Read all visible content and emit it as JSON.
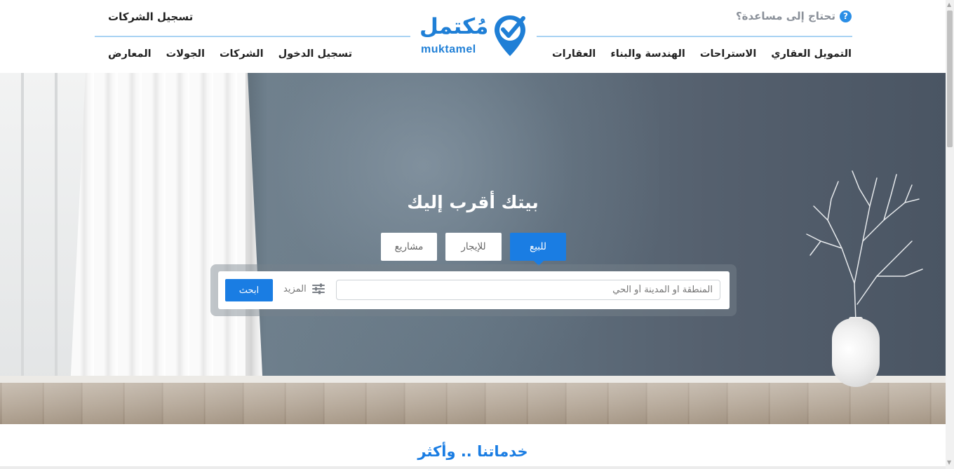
{
  "header": {
    "help_text": "تحتاج إلى مساعدة؟",
    "help_icon": "?",
    "register_companies": "تسجيل الشركات",
    "logo_ar": "مُكتمل",
    "logo_en": "muktamel",
    "nav_right": [
      "العقارات",
      "الهندسة والبناء",
      "الاستراحات",
      "التمويل العقاري"
    ],
    "nav_left": [
      "المعارض",
      "الجولات",
      "الشركات",
      "تسجيل الدخول"
    ]
  },
  "hero": {
    "title": "بيتك أقرب إليك",
    "tabs": [
      {
        "label": "للبيع",
        "active": true
      },
      {
        "label": "للإيجار",
        "active": false
      },
      {
        "label": "مشاريع",
        "active": false
      }
    ],
    "search": {
      "placeholder": "المنطقة او المدينة أو الحي",
      "more_label": "المزيد",
      "button_label": "ابحث"
    }
  },
  "services": {
    "title": "خدماتنا .. وأكثر"
  },
  "colors": {
    "accent": "#1a7de3",
    "logo": "#1f7fd6",
    "divider": "#a9d3f3"
  }
}
